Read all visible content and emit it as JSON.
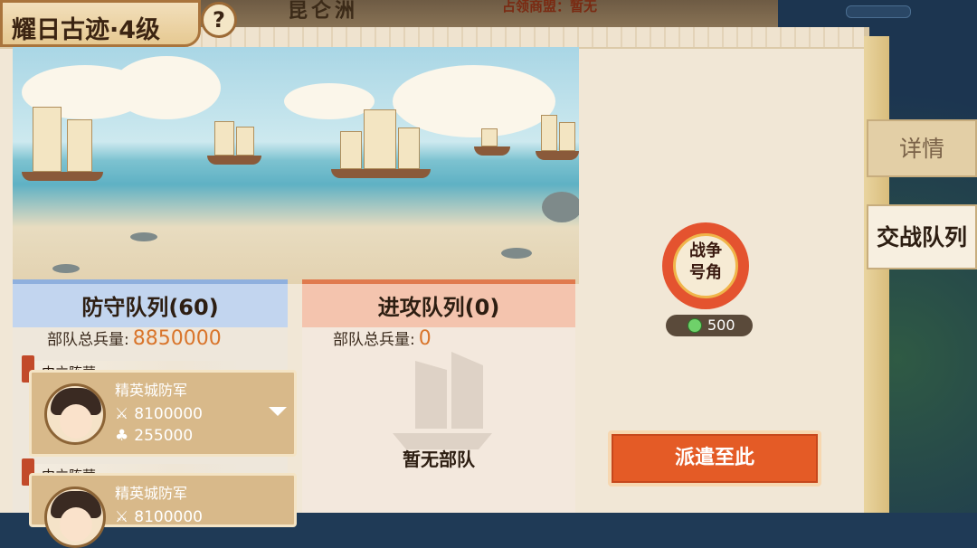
{
  "header": {
    "title": "耀日古迹·4级",
    "help_label": "?",
    "location": "昆仑洲",
    "occupant": "占领商盟：暂无"
  },
  "side_tabs": [
    {
      "label": "详情"
    },
    {
      "label": "交战队列"
    }
  ],
  "defense": {
    "heading": "防守队列(60)",
    "total_label": "部队总兵量:",
    "total_value": "8850000",
    "groups": [
      {
        "camp": "中立阵营",
        "unit_name": "精英城防军",
        "attack": "8100000",
        "troops": "255000"
      },
      {
        "camp": "中立阵营",
        "unit_name": "精英城防军",
        "attack": "8100000",
        "troops": ""
      }
    ]
  },
  "attack": {
    "heading": "进攻队列(0)",
    "total_label": "部队总兵量:",
    "total_value": "0",
    "empty_text": "暂无部队"
  },
  "war_horn": {
    "label_line1": "战争",
    "label_line2": "号角",
    "cost": "500"
  },
  "send_button": {
    "label": "派遣至此"
  },
  "icons": {
    "attack": "crossed-swords-icon",
    "troops": "soldiers-icon",
    "currency": "jade-coin-icon",
    "expand": "chevron-down-icon"
  },
  "colors": {
    "accent": "#e45b26",
    "defense_header": "#c2d5ef",
    "attack_header": "#f4c4ae",
    "total_value": "#d9752b"
  }
}
